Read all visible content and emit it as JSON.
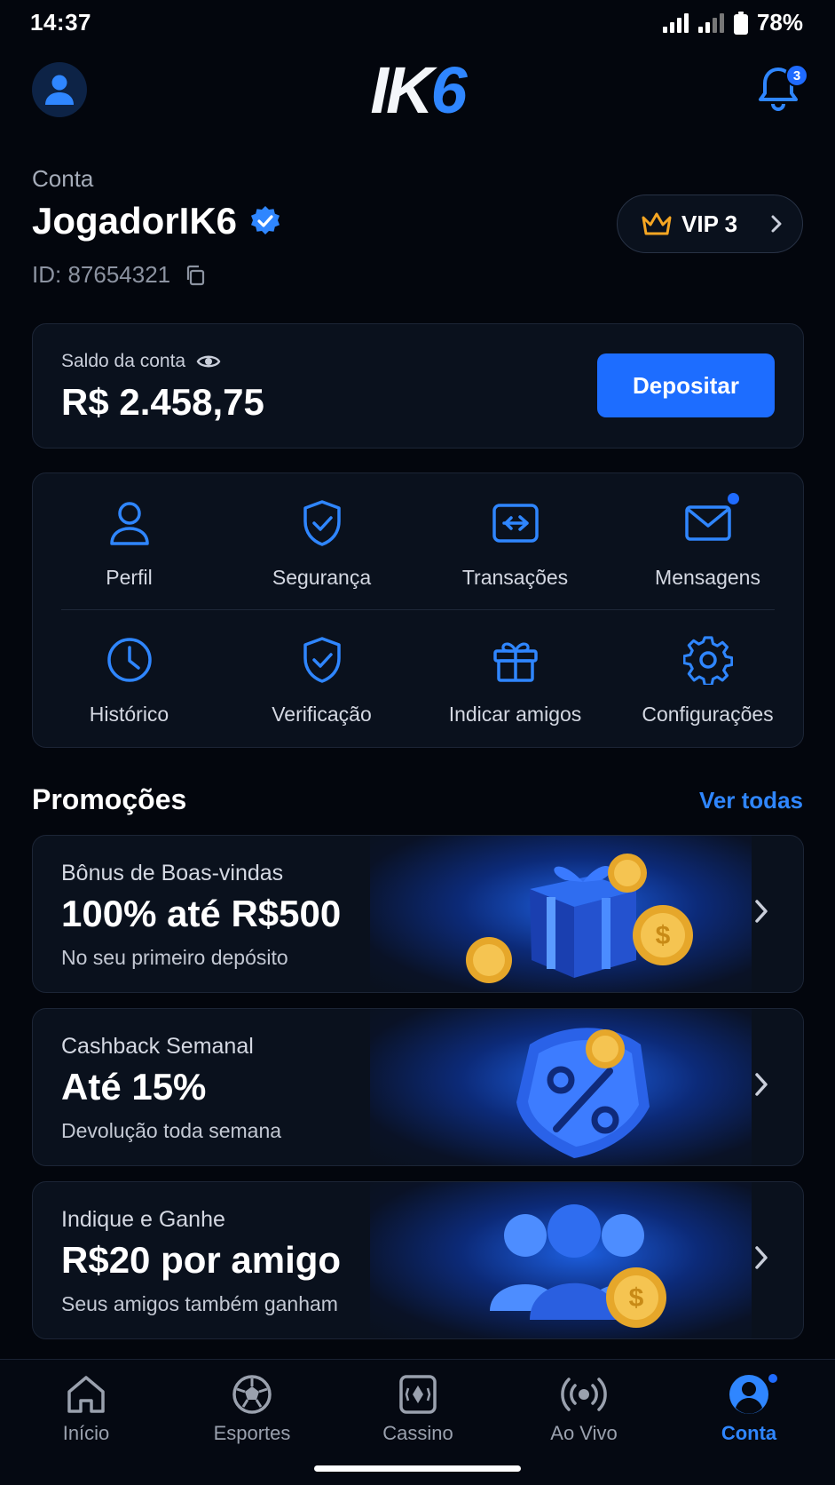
{
  "status_bar": {
    "time": "14:37",
    "battery": "78%"
  },
  "header": {
    "logo_part1": "IK",
    "logo_part2": "6",
    "notification_count": "3"
  },
  "account": {
    "label": "Conta",
    "username": "JogadorIK6",
    "id_text": "ID: 87654321",
    "vip_label": "VIP 3"
  },
  "balance": {
    "label": "Saldo da conta",
    "value": "R$ 2.458,75",
    "deposit_label": "Depositar"
  },
  "menu": {
    "items": [
      {
        "label": "Perfil",
        "icon": "user-icon"
      },
      {
        "label": "Segurança",
        "icon": "shield-check-icon"
      },
      {
        "label": "Transações",
        "icon": "transfer-icon"
      },
      {
        "label": "Mensagens",
        "icon": "mail-icon"
      },
      {
        "label": "Histórico",
        "icon": "clock-icon"
      },
      {
        "label": "Verificação",
        "icon": "shield-check-icon"
      },
      {
        "label": "Indicar amigos",
        "icon": "gift-icon"
      },
      {
        "label": "Configurações",
        "icon": "gear-icon"
      }
    ]
  },
  "promotions": {
    "title": "Promoções",
    "see_all": "Ver todas",
    "items": [
      {
        "subtitle": "Bônus de Boas-vindas",
        "headline": "100% até R$500",
        "description": "No seu primeiro depósito",
        "art": "gift-coins-art"
      },
      {
        "subtitle": "Cashback Semanal",
        "headline": "Até 15%",
        "description": "Devolução toda semana",
        "art": "percent-badge-art"
      },
      {
        "subtitle": "Indique e Ganhe",
        "headline": "R$20 por amigo",
        "description": "Seus amigos também ganham",
        "art": "friends-coin-art"
      }
    ]
  },
  "tabbar": {
    "tabs": [
      {
        "label": "Início",
        "icon": "home-icon"
      },
      {
        "label": "Esportes",
        "icon": "soccer-ball-icon"
      },
      {
        "label": "Cassino",
        "icon": "casino-icon"
      },
      {
        "label": "Ao Vivo",
        "icon": "live-broadcast-icon"
      },
      {
        "label": "Conta",
        "icon": "account-icon",
        "active": true
      }
    ]
  },
  "colors": {
    "accent": "#1d6dff",
    "background": "#03060d",
    "card": "#0a111d"
  }
}
